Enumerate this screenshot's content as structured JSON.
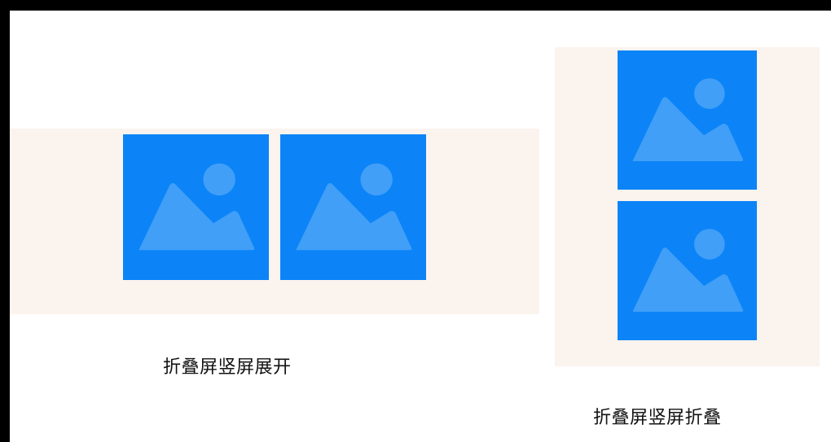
{
  "diagram": {
    "colors": {
      "background": "#ffffff",
      "panel": "#fbf3ee",
      "image_tile": "#0c84f7",
      "placeholder_glyph": "#ffffff"
    },
    "expanded": {
      "caption": "折叠屏竖屏展开",
      "tiles": [
        {
          "icon": "image-placeholder-icon"
        },
        {
          "icon": "image-placeholder-icon"
        }
      ]
    },
    "folded": {
      "caption": "折叠屏竖屏折叠",
      "tiles": [
        {
          "icon": "image-placeholder-icon"
        },
        {
          "icon": "image-placeholder-icon"
        }
      ]
    }
  }
}
